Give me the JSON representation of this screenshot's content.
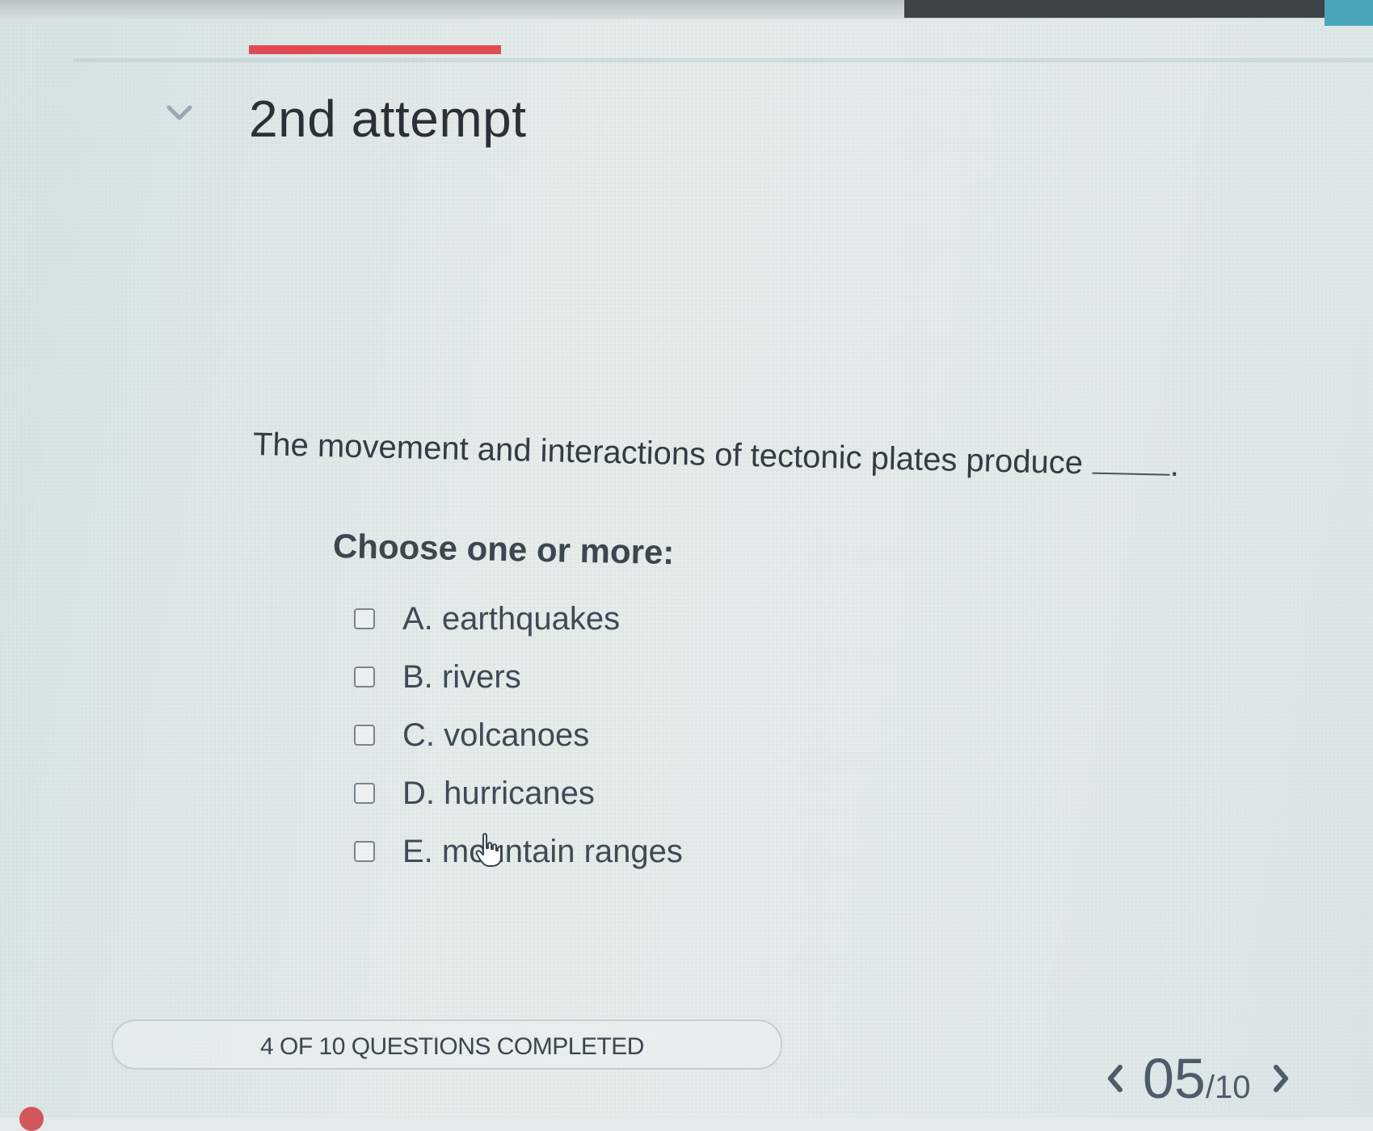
{
  "header": {
    "attempt_title": "2nd attempt",
    "progress_fraction": 0.4,
    "accent_color": "#e04a52"
  },
  "question": {
    "prompt": "The movement and interactions of tectonic plates produce",
    "prompt_end": ".",
    "instruction": "Choose one or more:",
    "options": [
      {
        "letter": "A.",
        "text": "earthquakes",
        "checked": false
      },
      {
        "letter": "B.",
        "text": "rivers",
        "checked": false
      },
      {
        "letter": "C.",
        "text": "volcanoes",
        "checked": false
      },
      {
        "letter": "D.",
        "text": "hurricanes",
        "checked": false
      },
      {
        "letter": "E.",
        "text": "mountain ranges",
        "checked": false
      }
    ]
  },
  "footer": {
    "status": "4 OF 10 QUESTIONS COMPLETED",
    "current_page": "05",
    "total_pages": "/10",
    "prev_icon": "chevron-left-icon",
    "next_icon": "chevron-right-icon"
  }
}
